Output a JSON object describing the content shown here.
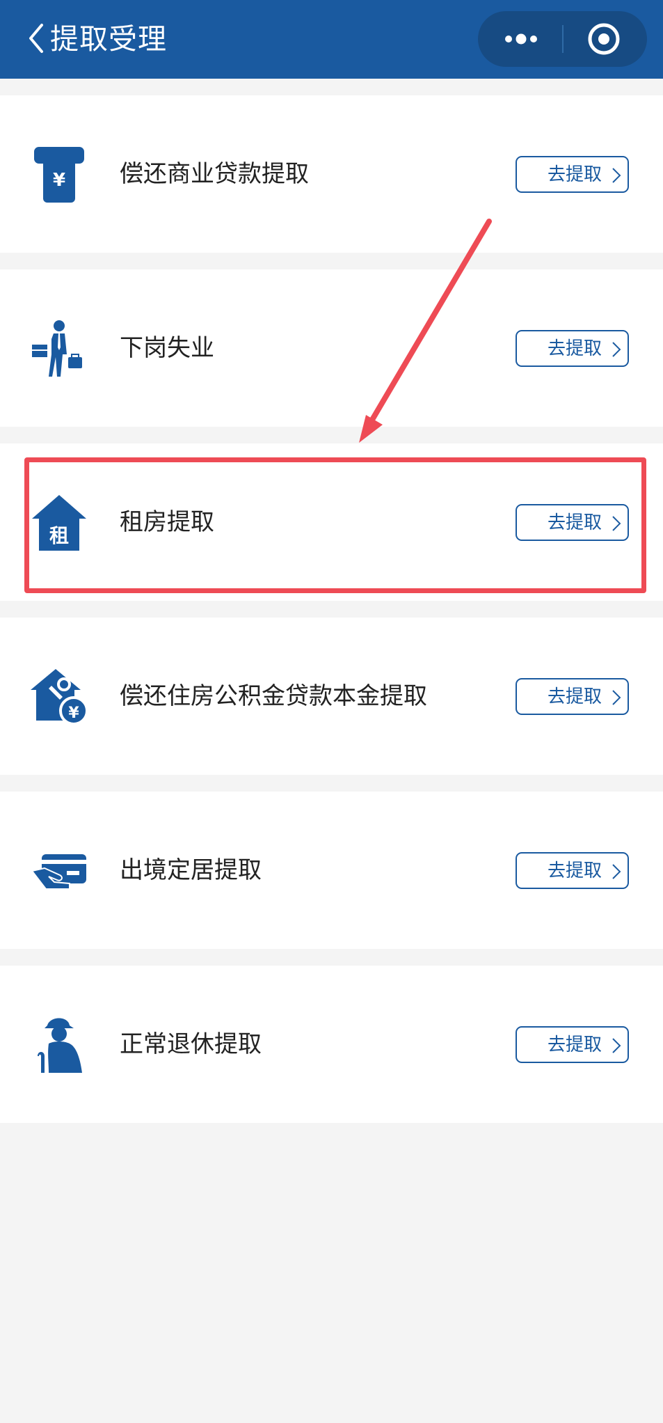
{
  "header": {
    "title": "提取受理"
  },
  "items": [
    {
      "label": "偿还商业贷款提取",
      "icon": "atm-yuan-icon",
      "action_label": "去提取"
    },
    {
      "label": "下岗失业",
      "icon": "unemployed-person-icon",
      "action_label": "去提取"
    },
    {
      "label": "租房提取",
      "icon": "rent-house-icon",
      "icon_text": "租",
      "action_label": "去提取"
    },
    {
      "label": "偿还住房公积金贷款本金提取",
      "icon": "house-repair-yuan-icon",
      "action_label": "去提取"
    },
    {
      "label": "出境定居提取",
      "icon": "hand-card-icon",
      "action_label": "去提取"
    },
    {
      "label": "正常退休提取",
      "icon": "elderly-person-icon",
      "action_label": "去提取"
    }
  ],
  "colors": {
    "header_bg": "#1a5aa0",
    "accent": "#1a5aa0",
    "annotation": "#ee4b55"
  }
}
